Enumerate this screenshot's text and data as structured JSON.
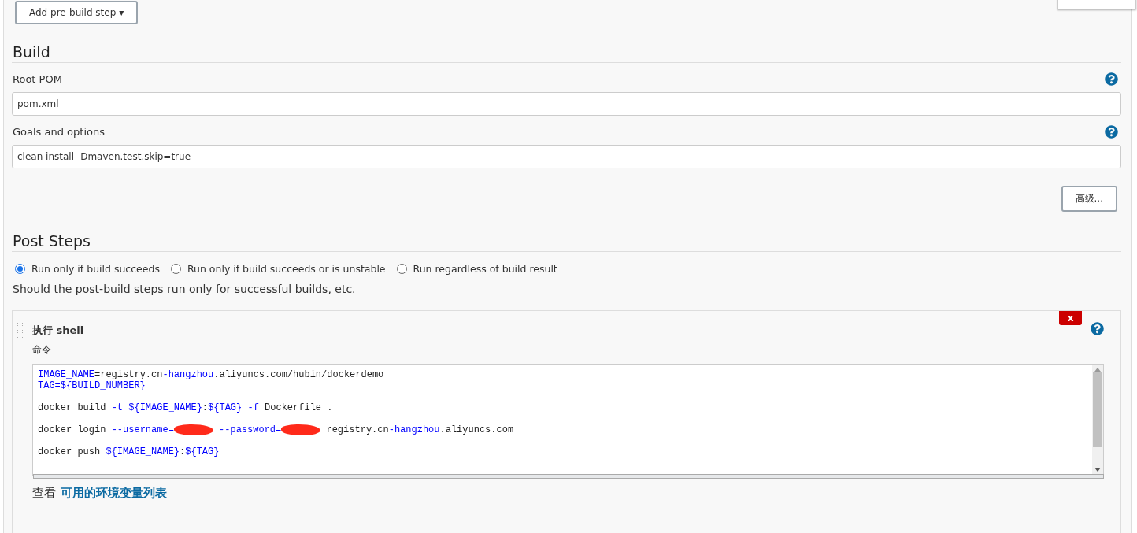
{
  "pre_build": {
    "button": "Add pre-build step",
    "caret": "▾"
  },
  "build": {
    "title": "Build",
    "fields": [
      {
        "label": "Root POM",
        "value": "pom.xml"
      },
      {
        "label": "Goals and options",
        "value": "clean install -Dmaven.test.skip=true"
      }
    ],
    "advanced_button": "高级..."
  },
  "post_steps": {
    "title": "Post Steps",
    "options": [
      {
        "label": "Run only if build succeeds",
        "selected": true
      },
      {
        "label": "Run only if build succeeds or is unstable",
        "selected": false
      },
      {
        "label": "Run regardless of build result",
        "selected": false
      }
    ],
    "description": "Should the post-build steps run only for successful builds, etc.",
    "step": {
      "title": "执行 shell",
      "delete": "x",
      "command_label": "命令",
      "lines": [
        {
          "kind": "code",
          "segments": [
            {
              "kind": "keyword",
              "text": "IMAGE_NAME"
            },
            {
              "kind": "plain",
              "text": "=registry.cn"
            },
            {
              "kind": "keyword",
              "text": "-hangzhou"
            },
            {
              "kind": "plain",
              "text": ".aliyuncs.com/hubin/dockerdemo"
            }
          ]
        },
        {
          "kind": "code",
          "segments": [
            {
              "kind": "keyword",
              "text": "TAG=${BUILD_NUMBER}"
            }
          ]
        },
        {
          "kind": "blank"
        },
        {
          "kind": "code",
          "segments": [
            {
              "kind": "plain",
              "text": "docker build "
            },
            {
              "kind": "keyword",
              "text": "-t ${IMAGE_NAME}"
            },
            {
              "kind": "plain",
              "text": ":"
            },
            {
              "kind": "keyword",
              "text": "${TAG} -f"
            },
            {
              "kind": "plain",
              "text": " Dockerfile ."
            }
          ]
        },
        {
          "kind": "blank"
        },
        {
          "kind": "code",
          "segments": [
            {
              "kind": "plain",
              "text": "docker login "
            },
            {
              "kind": "keyword",
              "text": "--username="
            },
            {
              "kind": "redacted"
            },
            {
              "kind": "keyword",
              "text": " --password="
            },
            {
              "kind": "redacted"
            },
            {
              "kind": "plain",
              "text": " registry.cn"
            },
            {
              "kind": "keyword",
              "text": "-hangzhou"
            },
            {
              "kind": "plain",
              "text": ".aliyuncs.com"
            }
          ]
        },
        {
          "kind": "blank"
        },
        {
          "kind": "code",
          "segments": [
            {
              "kind": "plain",
              "text": "docker push "
            },
            {
              "kind": "keyword",
              "text": "${IMAGE_NAME}"
            },
            {
              "kind": "plain",
              "text": ":"
            },
            {
              "kind": "keyword",
              "text": "${TAG}"
            }
          ]
        }
      ],
      "env_prefix": "查看",
      "env_link": "可用的环境变量列表"
    }
  }
}
